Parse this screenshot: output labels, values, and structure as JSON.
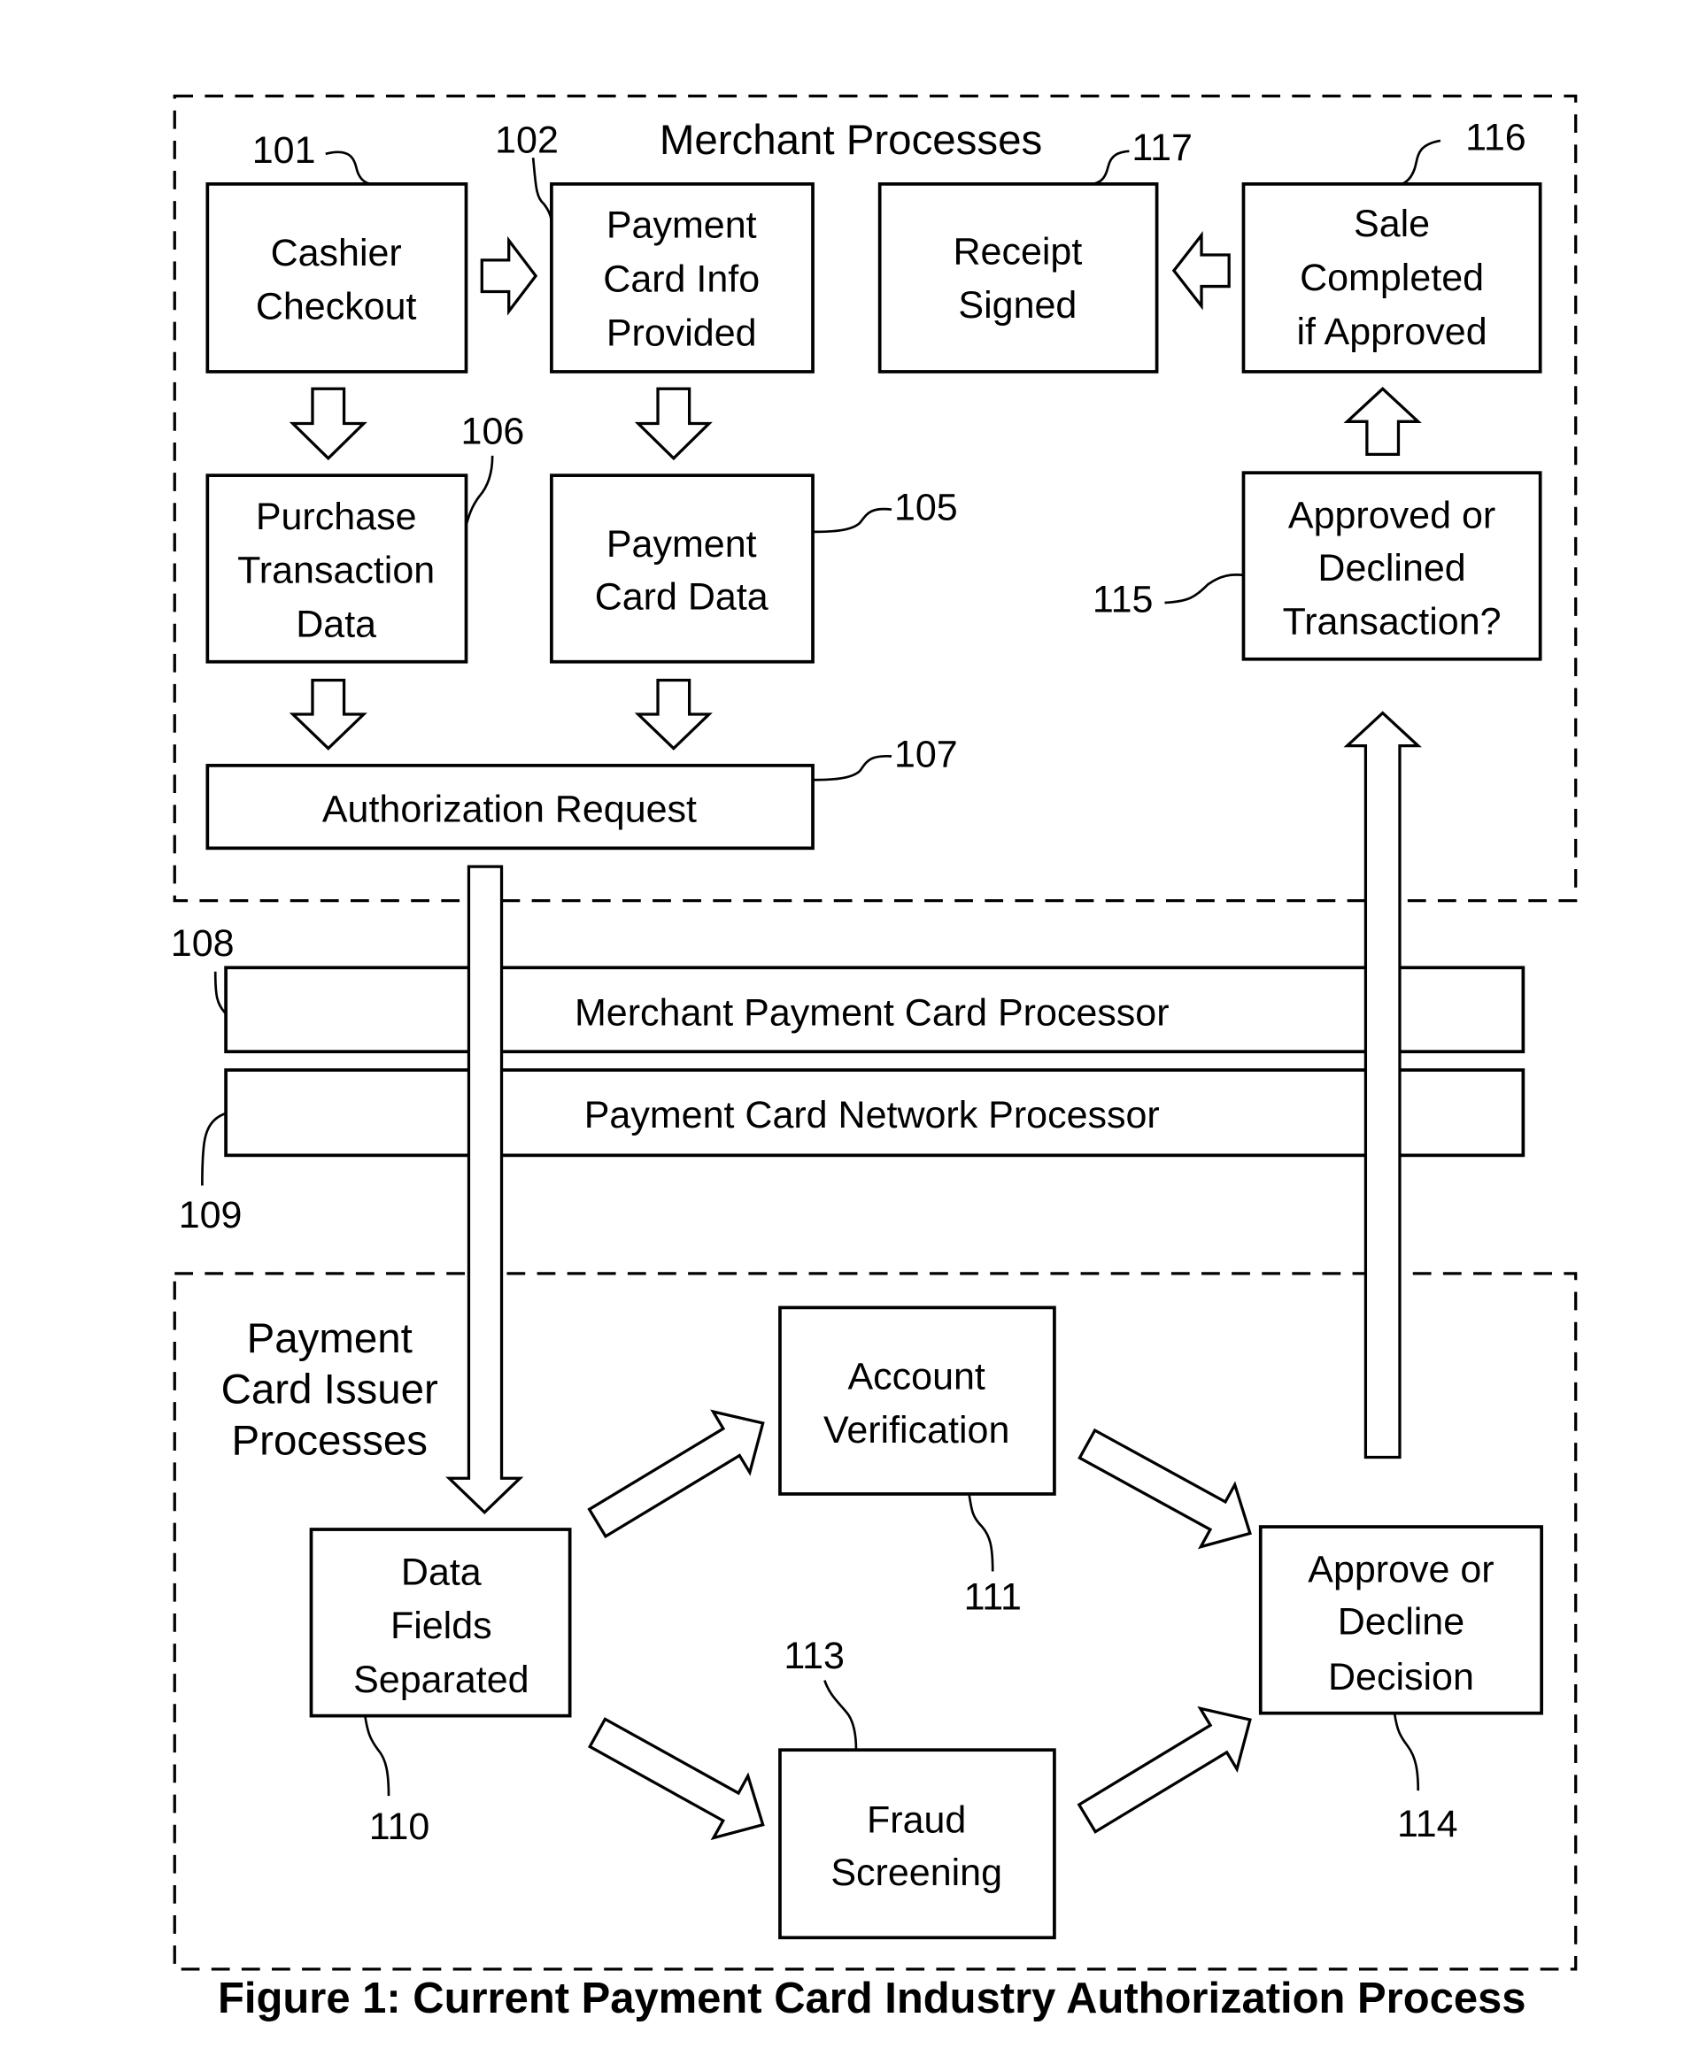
{
  "figure": {
    "caption": "Figure 1: Current Payment Card Industry Authorization Process",
    "merchant_group": {
      "title": "Merchant Processes"
    },
    "issuer_group": {
      "title_lines": [
        "Payment",
        "Card Issuer",
        "Processes"
      ]
    },
    "nodes": {
      "n101": {
        "ref": "101",
        "lines": [
          "Cashier",
          "Checkout"
        ]
      },
      "n102": {
        "ref": "102",
        "lines": [
          "Payment",
          "Card Info",
          "Provided"
        ]
      },
      "n117": {
        "ref": "117",
        "lines": [
          "Receipt",
          "Signed"
        ]
      },
      "n116": {
        "ref": "116",
        "lines": [
          "Sale",
          "Completed",
          "if Approved"
        ]
      },
      "n106": {
        "ref": "106",
        "lines": [
          "Purchase",
          "Transaction",
          "Data"
        ]
      },
      "n105": {
        "ref": "105",
        "lines": [
          "Payment",
          "Card Data"
        ]
      },
      "n115": {
        "ref": "115",
        "lines": [
          "Approved or",
          "Declined",
          "Transaction?"
        ]
      },
      "n107": {
        "ref": "107",
        "lines": [
          "Authorization Request"
        ]
      },
      "n108": {
        "ref": "108",
        "lines": [
          "Merchant Payment Card Processor"
        ]
      },
      "n109": {
        "ref": "109",
        "lines": [
          "Payment Card Network Processor"
        ]
      },
      "n110": {
        "ref": "110",
        "lines": [
          "Data",
          "Fields",
          "Separated"
        ]
      },
      "n111": {
        "ref": "111",
        "lines": [
          "Account",
          "Verification"
        ]
      },
      "n113": {
        "ref": "113",
        "lines": [
          "Fraud",
          "Screening"
        ]
      },
      "n114": {
        "ref": "114",
        "lines": [
          "Approve or",
          "Decline",
          "Decision"
        ]
      }
    },
    "edges": [
      {
        "from": "101",
        "to": "102"
      },
      {
        "from": "101",
        "to": "106"
      },
      {
        "from": "102",
        "to": "105"
      },
      {
        "from": "106",
        "to": "107"
      },
      {
        "from": "105",
        "to": "107"
      },
      {
        "from": "107",
        "to": "110",
        "via": [
          "108",
          "109"
        ]
      },
      {
        "from": "110",
        "to": "111"
      },
      {
        "from": "110",
        "to": "113"
      },
      {
        "from": "111",
        "to": "114"
      },
      {
        "from": "113",
        "to": "114"
      },
      {
        "from": "114",
        "to": "115",
        "via": [
          "109",
          "108"
        ]
      },
      {
        "from": "115",
        "to": "116"
      },
      {
        "from": "116",
        "to": "117"
      }
    ]
  }
}
